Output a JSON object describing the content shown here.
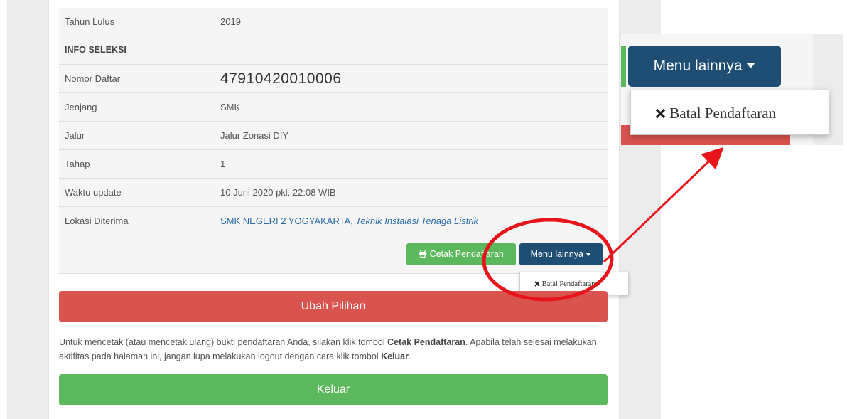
{
  "table": {
    "rows": [
      {
        "label": "Tahun Lulus",
        "value": "2019"
      },
      {
        "label": "INFO SELEKSI",
        "value": ""
      },
      {
        "label": "Nomor Daftar",
        "value": "47910420010006"
      },
      {
        "label": "Jenjang",
        "value": "SMK"
      },
      {
        "label": "Jalur",
        "value": "Jalur Zonasi DIY"
      },
      {
        "label": "Tahap",
        "value": "1"
      },
      {
        "label": "Waktu update",
        "value": "10 Juni 2020 pkl. 22:08 WIB"
      },
      {
        "label": "Lokasi Diterima",
        "school": "SMK NEGERI 2 YOGYAKARTA,",
        "program": "Teknik Instalasi Tenaga Listrik"
      }
    ]
  },
  "actions": {
    "cetak_label": "Cetak Pendaftaran",
    "menu_label": "Menu lainnya",
    "dropdown_item": "Batal Pendaftaran"
  },
  "buttons": {
    "ubah": "Ubah Pilihan",
    "keluar": "Keluar"
  },
  "note": {
    "part1": "Untuk mencetak (atau mencetak ulang) bukti pendaftaran Anda, silakan klik tombol ",
    "bold1": "Cetak Pendaftaran",
    "part2": ". Apabila telah selesai melakukan aktifitas pada halaman ini, jangan lupa melakukan logout dengan cara klik tombol ",
    "bold2": "Keluar",
    "part3": "."
  },
  "icons": {
    "printer": "printer-icon",
    "caret": "caret-down-icon",
    "times": "times-icon"
  },
  "colors": {
    "primary_dark": "#1f4e75",
    "success": "#5cb85c",
    "danger": "#d9534f",
    "annotation_red": "#e8141b",
    "link": "#2a6aa8"
  }
}
